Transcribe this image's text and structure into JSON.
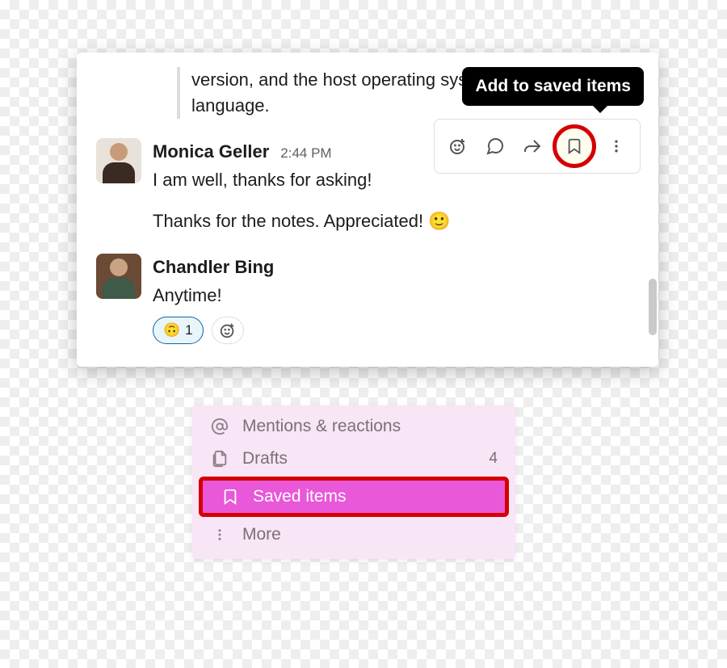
{
  "tooltip": {
    "label": "Add to saved items"
  },
  "prev_message": "version, and the host operating system language.",
  "messages": [
    {
      "author": "Monica Geller",
      "time": "2:44 PM",
      "lines": [
        "I am well, thanks for asking!",
        "Thanks for the notes. Appreciated!"
      ],
      "avatar_colors": {
        "bg": "#e9e2da",
        "head": "#c79b7a",
        "body": "#3a2a22"
      }
    },
    {
      "author": "Chandler Bing",
      "time": "",
      "lines": [
        "Anytime!"
      ],
      "avatar_colors": {
        "bg": "#6b4a36",
        "head": "#caa284",
        "body": "#3e5a48"
      },
      "reactions": [
        {
          "emoji": "🙃",
          "count": 1
        }
      ]
    }
  ],
  "sidebar": {
    "items": [
      {
        "id": "mentions",
        "label": "Mentions & reactions",
        "icon": "at",
        "count": null,
        "selected": false
      },
      {
        "id": "drafts",
        "label": "Drafts",
        "icon": "drafts",
        "count": 4,
        "selected": false
      },
      {
        "id": "saved",
        "label": "Saved items",
        "icon": "bookmark",
        "count": null,
        "selected": true
      },
      {
        "id": "more",
        "label": "More",
        "icon": "more",
        "count": null,
        "selected": false
      }
    ]
  }
}
